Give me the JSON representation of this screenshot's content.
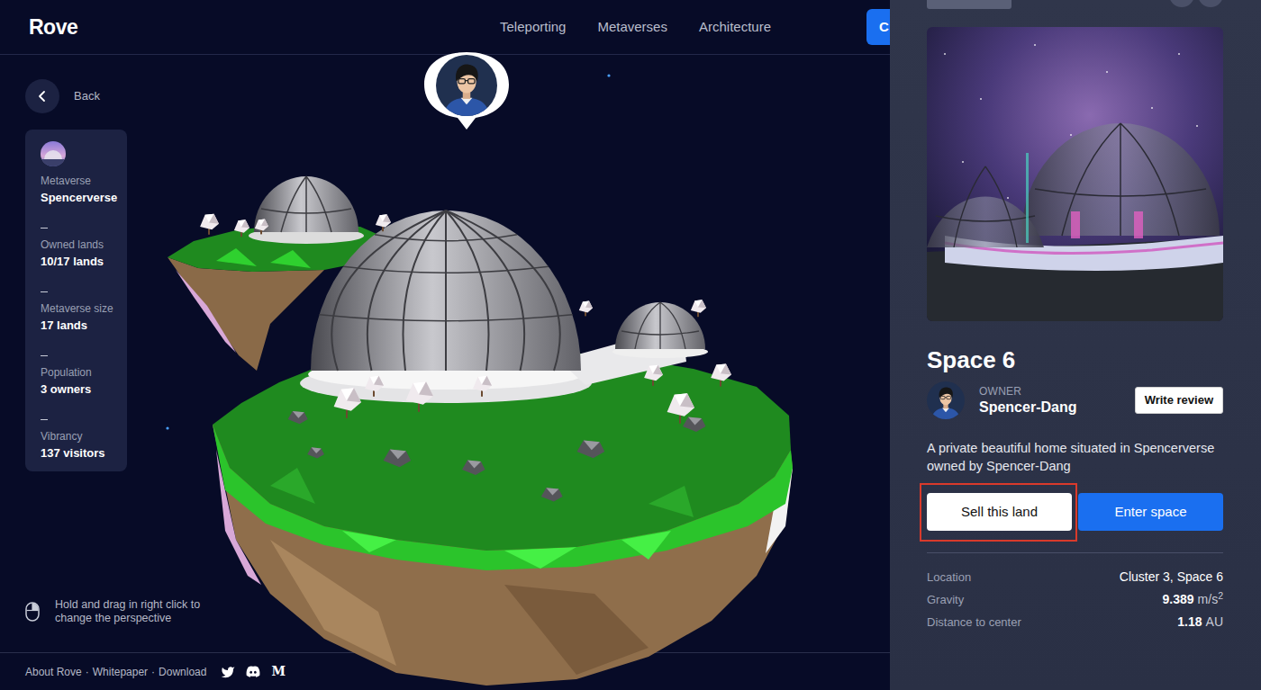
{
  "brand": "Rove",
  "nav": {
    "links": [
      {
        "label": "Teleporting"
      },
      {
        "label": "Metaverses"
      },
      {
        "label": "Architecture"
      }
    ],
    "cta": "C"
  },
  "back": {
    "label": "Back"
  },
  "stats": [
    {
      "label": "Metaverse",
      "value": "Spencerverse"
    },
    {
      "label": "Owned lands",
      "value": "10/17 lands"
    },
    {
      "label": "Metaverse size",
      "value": "17 lands"
    },
    {
      "label": "Population",
      "value": "3 owners"
    },
    {
      "label": "Vibrancy",
      "value": "137 visitors"
    }
  ],
  "hint": "Hold and drag in right click to change the perspective",
  "footer": {
    "links": [
      "About Rove",
      "Whitepaper",
      "Download"
    ],
    "separator": "·",
    "medium": "M"
  },
  "land": {
    "title": "Space 6",
    "owner_label": "OWNER",
    "owner": "Spencer-Dang",
    "review": "Write review",
    "description": "A private beautiful home situated in Spencerverse owned by Spencer-Dang",
    "actions": [
      {
        "label": "Sell this land",
        "kind": "light",
        "highlighted": true
      },
      {
        "label": "Enter space",
        "kind": "primary",
        "highlighted": false
      }
    ],
    "details": [
      {
        "label": "Location",
        "value": "Cluster 3, Space 6",
        "unit": "",
        "exp": ""
      },
      {
        "label": "Gravity",
        "value": "9.389",
        "unit": "m/s",
        "exp": "2"
      },
      {
        "label": "Distance to center",
        "value": "1.18",
        "unit": "AU",
        "exp": ""
      }
    ]
  }
}
